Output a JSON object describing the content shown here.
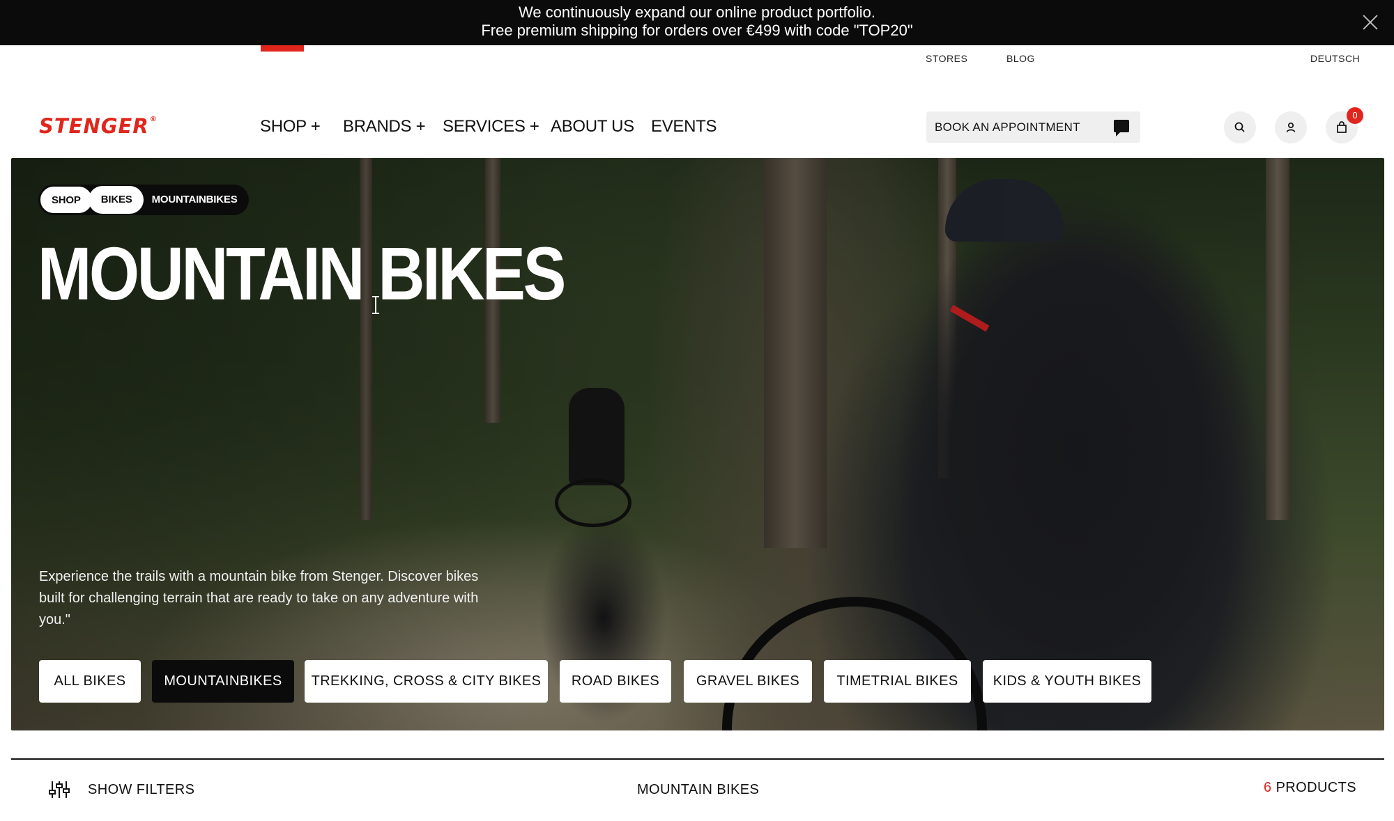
{
  "announcement": {
    "line1": "We continuously expand our online product portfolio.",
    "line2": "Free premium shipping for orders over €499 with code \"TOP20\""
  },
  "utility_nav": {
    "stores": "STORES",
    "blog": "BLOG",
    "language": "DEUTSCH"
  },
  "header": {
    "logo": "STENGER",
    "logo_mark": "®",
    "nav": [
      "SHOP +",
      "BRANDS +",
      "SERVICES +",
      "ABOUT US",
      "EVENTS"
    ],
    "appointment_label": "BOOK AN APPOINTMENT",
    "cart_count": "0"
  },
  "hero": {
    "breadcrumbs": [
      "SHOP",
      "BIKES",
      "MOUNTAINBIKES"
    ],
    "title": "MOUNTAIN BIKES",
    "description": "Experience the trails with a mountain bike from Stenger. Discover bikes built for challenging terrain that are ready to take on any adventure with you.\""
  },
  "categories": [
    {
      "label": "ALL BIKES",
      "active": false
    },
    {
      "label": "MOUNTAINBIKES",
      "active": true
    },
    {
      "label": "TREKKING, CROSS & CITY BIKES",
      "active": false
    },
    {
      "label": "ROAD BIKES",
      "active": false
    },
    {
      "label": "GRAVEL BIKES",
      "active": false
    },
    {
      "label": "TIMETRIAL BIKES",
      "active": false
    },
    {
      "label": "KIDS & YOUTH BIKES",
      "active": false
    }
  ],
  "filter_bar": {
    "show_filters": "SHOW FILTERS",
    "section_title": "MOUNTAIN BIKES",
    "product_count": "6",
    "product_label": "PRODUCTS"
  },
  "colors": {
    "brand_red": "#e0261c",
    "dark": "#0b0b0b"
  }
}
